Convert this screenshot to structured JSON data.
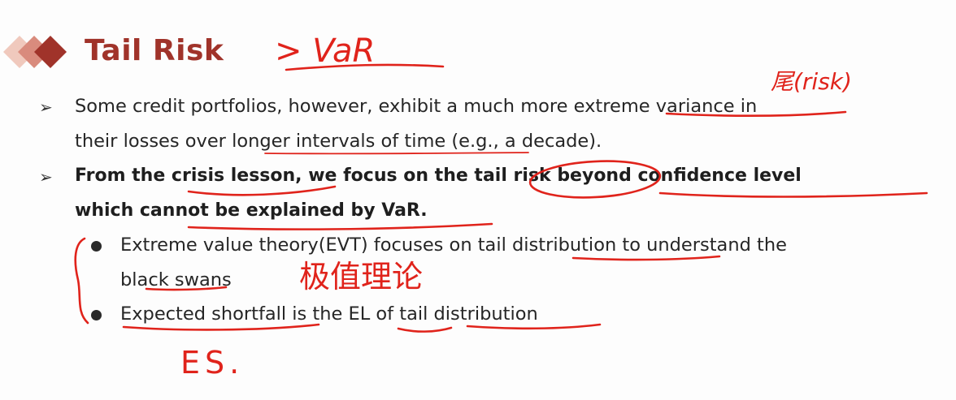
{
  "title": "Tail Risk",
  "bullets": [
    {
      "line1": "Some credit portfolios, however, exhibit a much more extreme variance in",
      "line2": "their losses over longer intervals of time (e.g., a decade)."
    },
    {
      "line1": "From the crisis lesson, we focus on the tail risk beyond confidence level",
      "line2": "which cannot be explained by VaR."
    }
  ],
  "sub_bullets": [
    {
      "line1": "Extreme value theory(EVT) focuses on tail distribution to understand the",
      "line2": "black swans"
    },
    {
      "line1": "Expected shortfall is the EL of tail distribution"
    }
  ],
  "handwriting": {
    "var_note": "> VaR",
    "risk_note": "尾(risk)",
    "evt_note": "极值理论",
    "es_note": "ES."
  },
  "colors": {
    "title": "#a0332a",
    "annotation": "#e0231b",
    "diamond_dark": "#a0332a",
    "diamond_mid": "#d98b7d",
    "diamond_light": "#f0c9bd"
  }
}
